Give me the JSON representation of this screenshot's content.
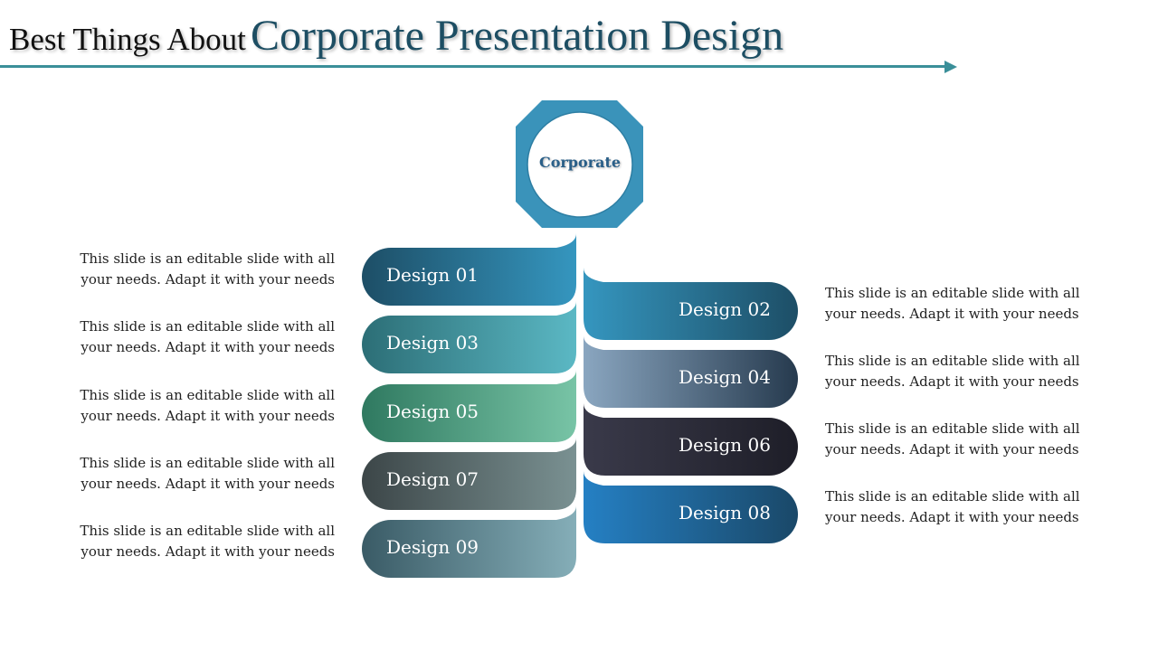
{
  "header": {
    "title_prefix": "Best Things About",
    "title_main": "Corporate Presentation Design",
    "accent_color": "#3a8f99"
  },
  "hub": {
    "label": "Corporate",
    "color": "#3a93ba"
  },
  "left_items": [
    {
      "label": "Design 01",
      "description_line1": "This slide is an editable slide with all",
      "description_line2": "your needs. Adapt it with your needs",
      "colors": [
        "#1d4e66",
        "#3596bf"
      ]
    },
    {
      "label": "Design 03",
      "description_line1": "This slide is an editable slide with all",
      "description_line2": "your needs. Adapt it with your needs",
      "colors": [
        "#2c6e76",
        "#5bb8c4"
      ]
    },
    {
      "label": "Design 05",
      "description_line1": "This slide is an editable slide with all",
      "description_line2": "your needs. Adapt it with your needs",
      "colors": [
        "#2f7960",
        "#78c4a6"
      ]
    },
    {
      "label": "Design 07",
      "description_line1": "This slide is an editable slide with all",
      "description_line2": "your needs. Adapt it with your needs",
      "colors": [
        "#3c4648",
        "#7a9192"
      ]
    },
    {
      "label": "Design 09",
      "description_line1": "This slide is an editable slide with all",
      "description_line2": "your needs. Adapt it with your needs",
      "colors": [
        "#3a5b66",
        "#85aeb8"
      ]
    }
  ],
  "right_items": [
    {
      "label": "Design 02",
      "description_line1": "This slide is an editable slide with all",
      "description_line2": "your needs. Adapt it with your needs",
      "colors": [
        "#3596bf",
        "#1d4e66"
      ]
    },
    {
      "label": "Design 04",
      "description_line1": "This slide is an editable slide with all",
      "description_line2": "your needs. Adapt it with your needs",
      "colors": [
        "#8aa6c0",
        "#263a4e"
      ]
    },
    {
      "label": "Design 06",
      "description_line1": "This slide is an editable slide with all",
      "description_line2": "your needs. Adapt it with your needs",
      "colors": [
        "#3a3a4a",
        "#1e1e28"
      ]
    },
    {
      "label": "Design 08",
      "description_line1": "This slide is an editable slide with all",
      "description_line2": "your needs. Adapt it with your needs",
      "colors": [
        "#2580c4",
        "#1a4868"
      ]
    }
  ]
}
